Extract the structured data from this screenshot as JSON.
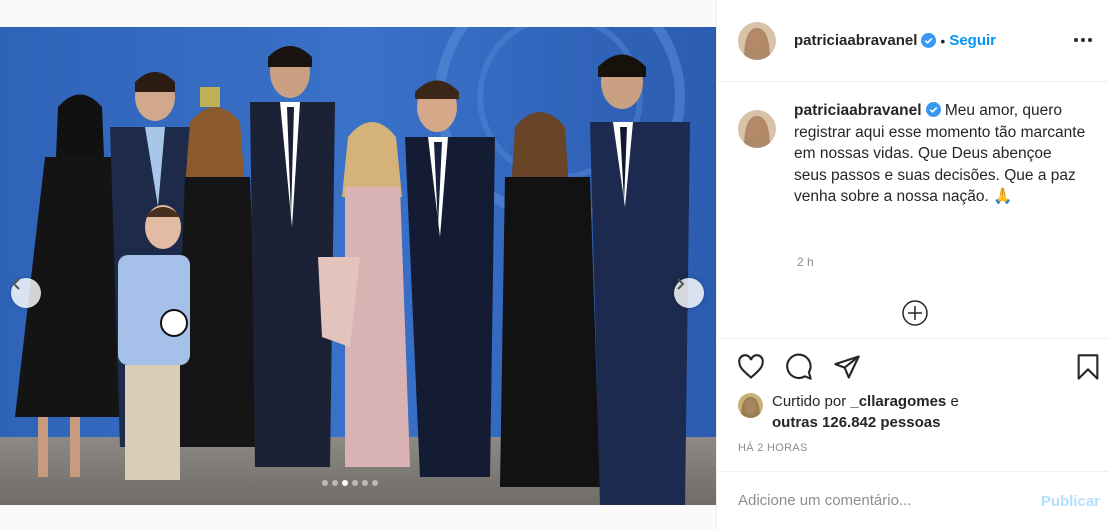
{
  "post": {
    "username": "patriciaabravanel",
    "separator": "•",
    "follow_label": "Seguir",
    "more_icon": "more-horizontal-icon",
    "verified_icon": "verified-badge-icon"
  },
  "caption": {
    "username": "patriciaabravanel",
    "text": "Meu amor, quero registrar aqui esse momento tão marcante em nossas vidas. Que Deus abençoe seus passos e suas decisões. Que a paz venha sobre a nossa nação. 🙏",
    "time": "2 h"
  },
  "likes": {
    "prefix": "Curtido por",
    "user": "_cllaragomes",
    "joiner": "e",
    "others": "outras 126.842 pessoas"
  },
  "timestamp": "HÁ 2 HORAS",
  "comment": {
    "placeholder": "Adicione um comentário...",
    "post_label": "Publicar"
  },
  "carousel": {
    "slide_count": 6,
    "active_index": 2
  },
  "colors": {
    "accent": "#0095f6",
    "post_disabled": "#b2dffc",
    "muted": "#8e8e8e",
    "backdrop_blue": "#2a5fb5"
  }
}
